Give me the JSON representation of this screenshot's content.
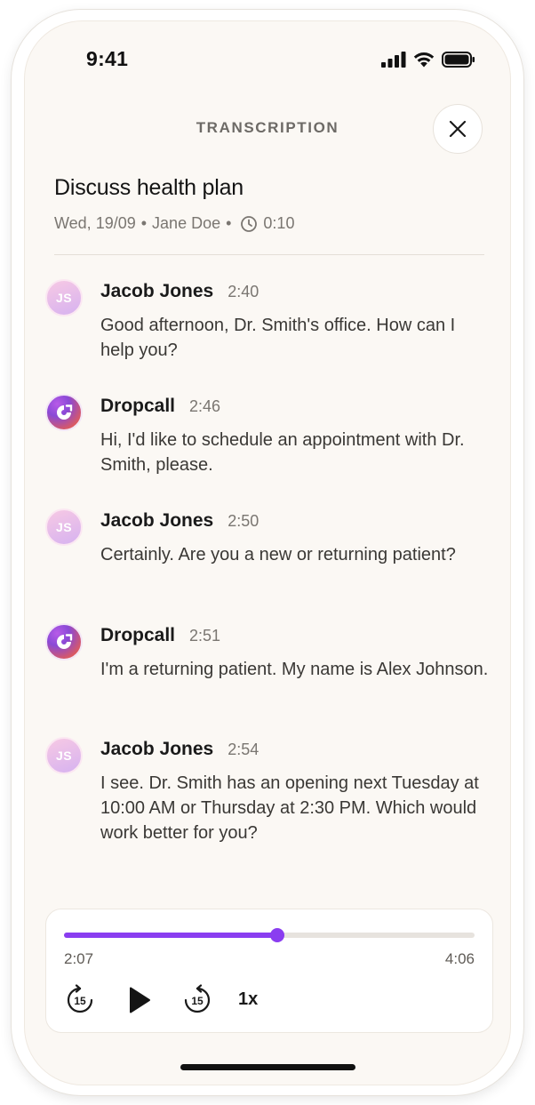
{
  "status_bar": {
    "time": "9:41"
  },
  "header": {
    "title": "TRANSCRIPTION",
    "close_icon": "close-icon"
  },
  "call": {
    "title": "Discuss health plan",
    "date": "Wed, 19/09",
    "separator": "•",
    "contact": "Jane Doe",
    "duration_icon": "clock-icon",
    "duration": "0:10"
  },
  "messages": [
    {
      "sender": "Jacob Jones",
      "initials": "JS",
      "time": "2:40",
      "text": "Good afternoon, Dr. Smith's office. How can I help you?"
    },
    {
      "sender": "Dropcall",
      "time": "2:46",
      "text": "Hi, I'd like to schedule an appointment with Dr. Smith, please."
    },
    {
      "sender": "Jacob Jones",
      "initials": "JS",
      "time": "2:50",
      "text": "Certainly. Are you a new or returning patient?"
    },
    {
      "sender": "Dropcall",
      "time": "2:51",
      "text": "I'm a returning patient. My name is Alex Johnson."
    },
    {
      "sender": "Jacob Jones",
      "initials": "JS",
      "time": "2:54",
      "text": "I see. Dr. Smith has an opening next Tuesday at 10:00 AM or Thursday at 2:30 PM. Which would work better for you?"
    }
  ],
  "player": {
    "position": "2:07",
    "duration": "4:06",
    "progress": 0.52,
    "speed": "1x",
    "rewind_label": "15",
    "forward_label": "15",
    "accent_color": "#8a3df0"
  }
}
